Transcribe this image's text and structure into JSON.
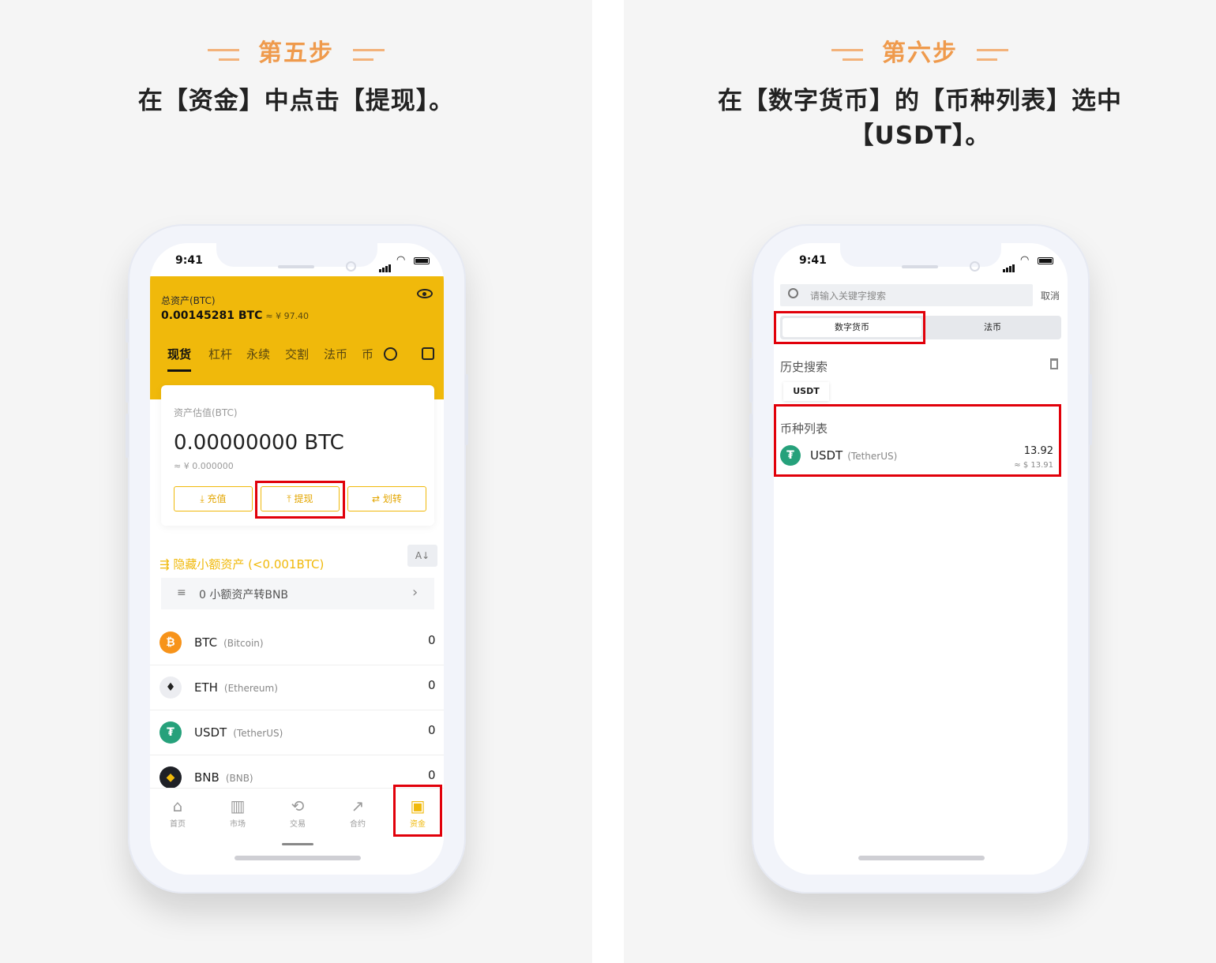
{
  "left": {
    "step_title": "第五步",
    "instruction": "在【资金】中点击【提现】。",
    "status_time": "9:41",
    "header": {
      "total_label": "总资产(BTC)",
      "total_value": "0.00145281 BTC",
      "total_cny": "≈ ¥ 97.40",
      "tabs": [
        "现货",
        "杠杆",
        "永续",
        "交割",
        "法币",
        "币"
      ]
    },
    "card": {
      "caption": "资产估值(BTC)",
      "value": "0.00000000 BTC",
      "cny": "≈ ¥ 0.000000",
      "deposit": "充值",
      "withdraw": "提现",
      "transfer": "划转"
    },
    "hide_small": "隐藏小额资产 (<0.001BTC)",
    "bnb_convert": "0 小额资产转BNB",
    "coins": [
      {
        "symbol": "BTC",
        "name": "(Bitcoin)",
        "amount": "0",
        "color": "#f7931a",
        "glyph": "₿"
      },
      {
        "symbol": "ETH",
        "name": "(Ethereum)",
        "amount": "0",
        "color": "#ecedf1",
        "glyph": "♦"
      },
      {
        "symbol": "USDT",
        "name": "(TetherUS)",
        "amount": "0",
        "color": "#26a17b",
        "glyph": "₮"
      },
      {
        "symbol": "BNB",
        "name": "(BNB)",
        "amount": "0",
        "color": "#1e2026",
        "glyph": "◆"
      }
    ],
    "tabbar": [
      "首页",
      "市场",
      "交易",
      "合约",
      "资金"
    ]
  },
  "right": {
    "step_title": "第六步",
    "instruction_line1": "在【数字货币】的【币种列表】选中",
    "instruction_line2": "【USDT】。",
    "status_time": "9:41",
    "search_placeholder": "请输入关键字搜索",
    "cancel": "取消",
    "seg_active": "数字货币",
    "seg_other": "法币",
    "history_label": "历史搜索",
    "history_chip": "USDT",
    "list_caption": "币种列表",
    "coin": {
      "symbol": "USDT",
      "name": "(TetherUS)",
      "amount": "13.92",
      "usd": "≈ $ 13.91"
    }
  },
  "colors": {
    "accent": "#f0b90b",
    "highlight": "#e1000a",
    "step": "#ef9a4c"
  }
}
